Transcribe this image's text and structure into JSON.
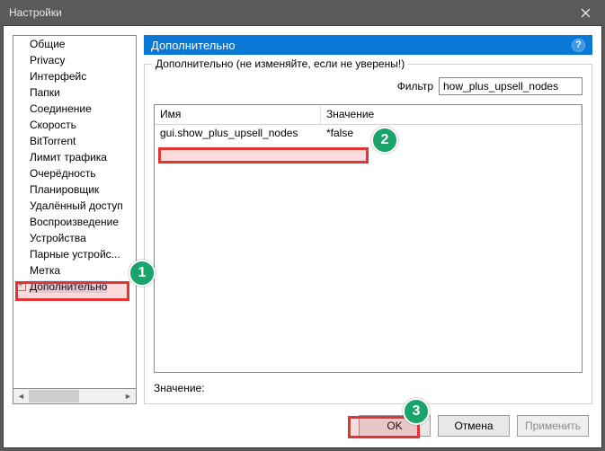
{
  "window": {
    "title": "Настройки"
  },
  "sidebar": {
    "items": [
      {
        "label": "Общие"
      },
      {
        "label": "Privacy"
      },
      {
        "label": "Интерфейс"
      },
      {
        "label": "Папки"
      },
      {
        "label": "Соединение"
      },
      {
        "label": "Скорость"
      },
      {
        "label": "BitTorrent"
      },
      {
        "label": "Лимит трафика"
      },
      {
        "label": "Очерёдность"
      },
      {
        "label": "Планировщик"
      },
      {
        "label": "Удалённый доступ"
      },
      {
        "label": "Воспроизведение"
      },
      {
        "label": "Устройства"
      },
      {
        "label": "Парные устройс..."
      },
      {
        "label": "Метка"
      },
      {
        "label": "Дополнительно"
      }
    ],
    "selected_index": 15
  },
  "panel": {
    "title": "Дополнительно",
    "groupbox_label": "Дополнительно (не изменяйте, если не уверены!)",
    "filter_label": "Фильтр",
    "filter_value": "how_plus_upsell_nodes",
    "columns": {
      "name": "Имя",
      "value": "Значение"
    },
    "rows": [
      {
        "name": "gui.show_plus_upsell_nodes",
        "value": "*false"
      }
    ],
    "value_label": "Значение:"
  },
  "buttons": {
    "ok": "OK",
    "cancel": "Отмена",
    "apply": "Применить"
  },
  "annotations": {
    "b1": "1",
    "b2": "2",
    "b3": "3"
  }
}
